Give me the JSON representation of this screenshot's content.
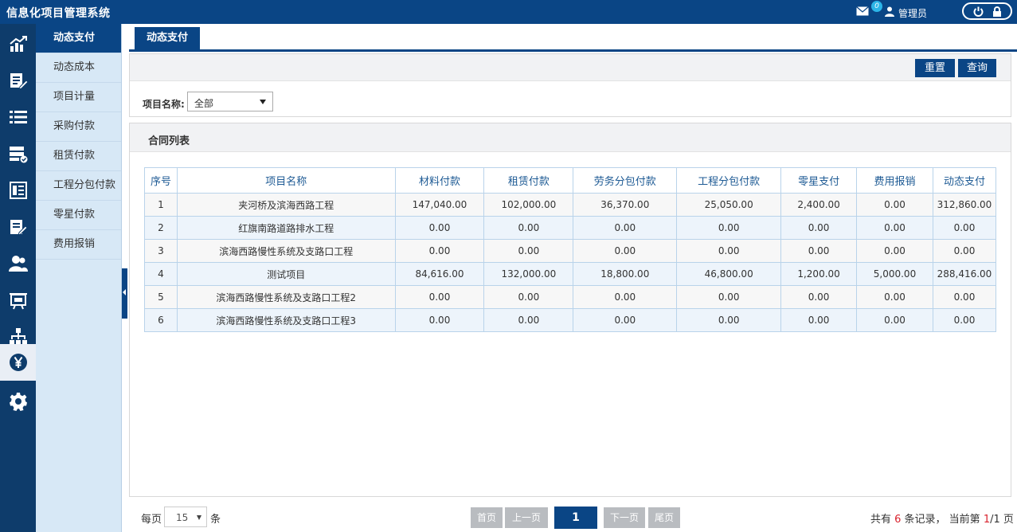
{
  "app": {
    "title": "信息化项目管理系统",
    "user": "管理员",
    "mail_badge": "0"
  },
  "rail": {
    "items": [
      {
        "icon": "chart-up-icon"
      },
      {
        "icon": "edit-doc-icon"
      },
      {
        "icon": "list-icon"
      },
      {
        "icon": "server-check-icon"
      },
      {
        "icon": "book-icon"
      },
      {
        "icon": "edit-icon"
      },
      {
        "icon": "users-icon"
      },
      {
        "icon": "presentation-icon"
      },
      {
        "icon": "org-chart-icon"
      },
      {
        "icon": "yen-icon"
      },
      {
        "icon": "gear-icon"
      }
    ],
    "active_index": 9
  },
  "submenu": {
    "items": [
      {
        "label": "动态支付"
      },
      {
        "label": "动态成本"
      },
      {
        "label": "项目计量"
      },
      {
        "label": "采购付款"
      },
      {
        "label": "租赁付款"
      },
      {
        "label": "工程分包付款"
      },
      {
        "label": "零星付款"
      },
      {
        "label": "费用报销"
      }
    ],
    "active_index": 0
  },
  "tab": {
    "label": "动态支付"
  },
  "search": {
    "reset_label": "重置",
    "query_label": "查询",
    "project_label": "项目名称:",
    "project_value": "全部"
  },
  "list": {
    "title": "合同列表",
    "columns": [
      "序号",
      "项目名称",
      "材料付款",
      "租赁付款",
      "劳务分包付款",
      "工程分包付款",
      "零星支付",
      "费用报销",
      "动态支付"
    ],
    "rows": [
      [
        "1",
        "夹河桥及滨海西路工程",
        "147,040.00",
        "102,000.00",
        "36,370.00",
        "25,050.00",
        "2,400.00",
        "0.00",
        "312,860.00"
      ],
      [
        "2",
        "红旗南路道路排水工程",
        "0.00",
        "0.00",
        "0.00",
        "0.00",
        "0.00",
        "0.00",
        "0.00"
      ],
      [
        "3",
        "滨海西路慢性系统及支路口工程",
        "0.00",
        "0.00",
        "0.00",
        "0.00",
        "0.00",
        "0.00",
        "0.00"
      ],
      [
        "4",
        "测试项目",
        "84,616.00",
        "132,000.00",
        "18,800.00",
        "46,800.00",
        "1,200.00",
        "5,000.00",
        "288,416.00"
      ],
      [
        "5",
        "滨海西路慢性系统及支路口工程2",
        "0.00",
        "0.00",
        "0.00",
        "0.00",
        "0.00",
        "0.00",
        "0.00"
      ],
      [
        "6",
        "滨海西路慢性系统及支路口工程3",
        "0.00",
        "0.00",
        "0.00",
        "0.00",
        "0.00",
        "0.00",
        "0.00"
      ]
    ]
  },
  "pager": {
    "per_page_label": "每页",
    "per_page_value": "15",
    "per_page_unit": "条",
    "first": "首页",
    "prev": "上一页",
    "current": "1",
    "next": "下一页",
    "last": "尾页",
    "summary_prefix": "共有 ",
    "total": "6",
    "summary_mid": " 条记录， 当前第 ",
    "page": "1",
    "summary_slash": "/",
    "page_total": "1",
    "summary_suffix": " 页"
  },
  "colors": {
    "primary": "#0a4585",
    "rail_bg": "#0e3c6b",
    "submenu_bg": "#d7e8f6",
    "highlight_red": "#d9232e"
  }
}
